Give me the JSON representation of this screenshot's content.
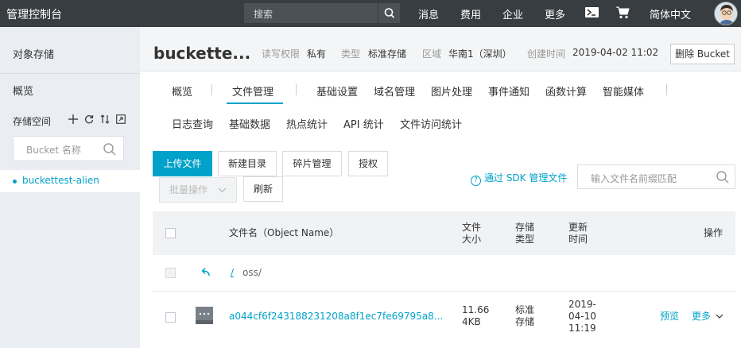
{
  "topbar": {
    "brand": "管理控制台",
    "search_placeholder": "搜索",
    "nav": [
      "消息",
      "费用",
      "企业",
      "更多"
    ],
    "language": "简体中文"
  },
  "sidebar": {
    "title": "对象存储",
    "overview": "概览",
    "storage_label": "存储空间",
    "bucket_search_placeholder": "Bucket 名称",
    "buckets": [
      "buckettest-alien"
    ]
  },
  "header": {
    "bucket_name": "buckette...",
    "rw_label": "读写权限",
    "rw_value": "私有",
    "type_label": "类型",
    "type_value": "标准存储",
    "region_label": "区域",
    "region_value": "华南1（深圳）",
    "created_label": "创建时间",
    "created_value": "2019-04-02 11:02",
    "delete_button": "删除 Bucket"
  },
  "tabs": {
    "row1": [
      "概览",
      "文件管理",
      "基础设置",
      "域名管理",
      "图片处理",
      "事件通知",
      "函数计算",
      "智能媒体"
    ],
    "row2": [
      "日志查询",
      "基础数据",
      "热点统计",
      "API 统计",
      "文件访问统计"
    ],
    "active": "文件管理"
  },
  "toolbar": {
    "upload": "上传文件",
    "new_dir": "新建目录",
    "fragments": "碎片管理",
    "authorize": "授权",
    "batch": "批量操作",
    "refresh": "刷新",
    "sdk_link": "通过 SDK 管理文件",
    "file_search_placeholder": "输入文件名前缀匹配"
  },
  "table": {
    "headers": {
      "name": "文件名（Object Name）",
      "size_1": "文件",
      "size_2": "大小",
      "type_1": "存储",
      "type_2": "类型",
      "updated_1": "更新",
      "updated_2": "时间",
      "actions": "操作"
    },
    "path": "oss/",
    "path_root": "/",
    "rows": [
      {
        "name": "a044cf6f243188231208a8f1ec7fe69795a8...",
        "size_1": "11.66",
        "size_2": "4KB",
        "type_1": "标准",
        "type_2": "存储",
        "date_1": "2019-",
        "date_2": "04-10",
        "date_3": "11:19",
        "preview": "预览",
        "more": "更多"
      }
    ]
  },
  "colors": {
    "accent": "#00a2ca",
    "topbar": "#373d41",
    "sidebar": "#eaedf1"
  }
}
